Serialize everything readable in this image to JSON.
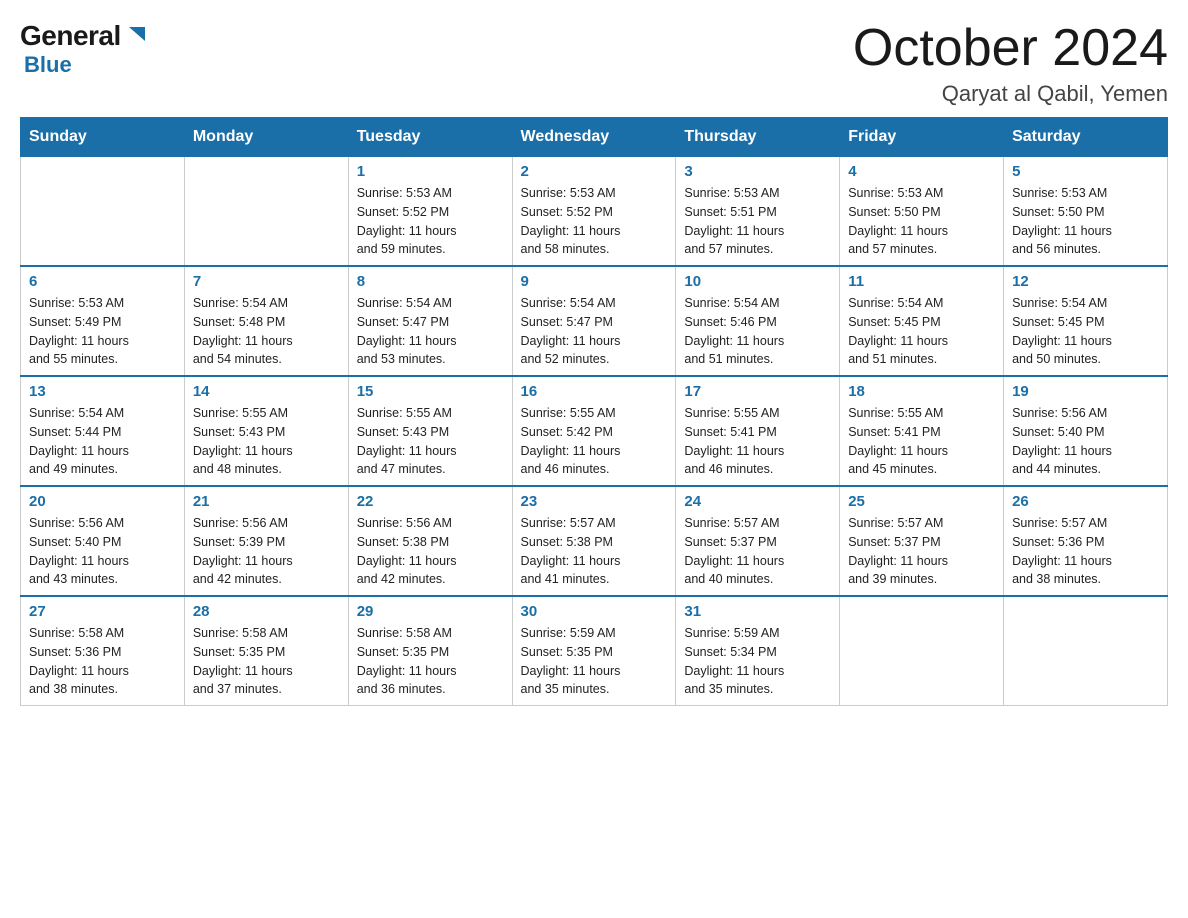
{
  "logo": {
    "general": "General",
    "blue": "Blue"
  },
  "title": "October 2024",
  "subtitle": "Qaryat al Qabil, Yemen",
  "days_of_week": [
    "Sunday",
    "Monday",
    "Tuesday",
    "Wednesday",
    "Thursday",
    "Friday",
    "Saturday"
  ],
  "weeks": [
    [
      {
        "day": "",
        "info": ""
      },
      {
        "day": "",
        "info": ""
      },
      {
        "day": "1",
        "info": "Sunrise: 5:53 AM\nSunset: 5:52 PM\nDaylight: 11 hours\nand 59 minutes."
      },
      {
        "day": "2",
        "info": "Sunrise: 5:53 AM\nSunset: 5:52 PM\nDaylight: 11 hours\nand 58 minutes."
      },
      {
        "day": "3",
        "info": "Sunrise: 5:53 AM\nSunset: 5:51 PM\nDaylight: 11 hours\nand 57 minutes."
      },
      {
        "day": "4",
        "info": "Sunrise: 5:53 AM\nSunset: 5:50 PM\nDaylight: 11 hours\nand 57 minutes."
      },
      {
        "day": "5",
        "info": "Sunrise: 5:53 AM\nSunset: 5:50 PM\nDaylight: 11 hours\nand 56 minutes."
      }
    ],
    [
      {
        "day": "6",
        "info": "Sunrise: 5:53 AM\nSunset: 5:49 PM\nDaylight: 11 hours\nand 55 minutes."
      },
      {
        "day": "7",
        "info": "Sunrise: 5:54 AM\nSunset: 5:48 PM\nDaylight: 11 hours\nand 54 minutes."
      },
      {
        "day": "8",
        "info": "Sunrise: 5:54 AM\nSunset: 5:47 PM\nDaylight: 11 hours\nand 53 minutes."
      },
      {
        "day": "9",
        "info": "Sunrise: 5:54 AM\nSunset: 5:47 PM\nDaylight: 11 hours\nand 52 minutes."
      },
      {
        "day": "10",
        "info": "Sunrise: 5:54 AM\nSunset: 5:46 PM\nDaylight: 11 hours\nand 51 minutes."
      },
      {
        "day": "11",
        "info": "Sunrise: 5:54 AM\nSunset: 5:45 PM\nDaylight: 11 hours\nand 51 minutes."
      },
      {
        "day": "12",
        "info": "Sunrise: 5:54 AM\nSunset: 5:45 PM\nDaylight: 11 hours\nand 50 minutes."
      }
    ],
    [
      {
        "day": "13",
        "info": "Sunrise: 5:54 AM\nSunset: 5:44 PM\nDaylight: 11 hours\nand 49 minutes."
      },
      {
        "day": "14",
        "info": "Sunrise: 5:55 AM\nSunset: 5:43 PM\nDaylight: 11 hours\nand 48 minutes."
      },
      {
        "day": "15",
        "info": "Sunrise: 5:55 AM\nSunset: 5:43 PM\nDaylight: 11 hours\nand 47 minutes."
      },
      {
        "day": "16",
        "info": "Sunrise: 5:55 AM\nSunset: 5:42 PM\nDaylight: 11 hours\nand 46 minutes."
      },
      {
        "day": "17",
        "info": "Sunrise: 5:55 AM\nSunset: 5:41 PM\nDaylight: 11 hours\nand 46 minutes."
      },
      {
        "day": "18",
        "info": "Sunrise: 5:55 AM\nSunset: 5:41 PM\nDaylight: 11 hours\nand 45 minutes."
      },
      {
        "day": "19",
        "info": "Sunrise: 5:56 AM\nSunset: 5:40 PM\nDaylight: 11 hours\nand 44 minutes."
      }
    ],
    [
      {
        "day": "20",
        "info": "Sunrise: 5:56 AM\nSunset: 5:40 PM\nDaylight: 11 hours\nand 43 minutes."
      },
      {
        "day": "21",
        "info": "Sunrise: 5:56 AM\nSunset: 5:39 PM\nDaylight: 11 hours\nand 42 minutes."
      },
      {
        "day": "22",
        "info": "Sunrise: 5:56 AM\nSunset: 5:38 PM\nDaylight: 11 hours\nand 42 minutes."
      },
      {
        "day": "23",
        "info": "Sunrise: 5:57 AM\nSunset: 5:38 PM\nDaylight: 11 hours\nand 41 minutes."
      },
      {
        "day": "24",
        "info": "Sunrise: 5:57 AM\nSunset: 5:37 PM\nDaylight: 11 hours\nand 40 minutes."
      },
      {
        "day": "25",
        "info": "Sunrise: 5:57 AM\nSunset: 5:37 PM\nDaylight: 11 hours\nand 39 minutes."
      },
      {
        "day": "26",
        "info": "Sunrise: 5:57 AM\nSunset: 5:36 PM\nDaylight: 11 hours\nand 38 minutes."
      }
    ],
    [
      {
        "day": "27",
        "info": "Sunrise: 5:58 AM\nSunset: 5:36 PM\nDaylight: 11 hours\nand 38 minutes."
      },
      {
        "day": "28",
        "info": "Sunrise: 5:58 AM\nSunset: 5:35 PM\nDaylight: 11 hours\nand 37 minutes."
      },
      {
        "day": "29",
        "info": "Sunrise: 5:58 AM\nSunset: 5:35 PM\nDaylight: 11 hours\nand 36 minutes."
      },
      {
        "day": "30",
        "info": "Sunrise: 5:59 AM\nSunset: 5:35 PM\nDaylight: 11 hours\nand 35 minutes."
      },
      {
        "day": "31",
        "info": "Sunrise: 5:59 AM\nSunset: 5:34 PM\nDaylight: 11 hours\nand 35 minutes."
      },
      {
        "day": "",
        "info": ""
      },
      {
        "day": "",
        "info": ""
      }
    ]
  ]
}
